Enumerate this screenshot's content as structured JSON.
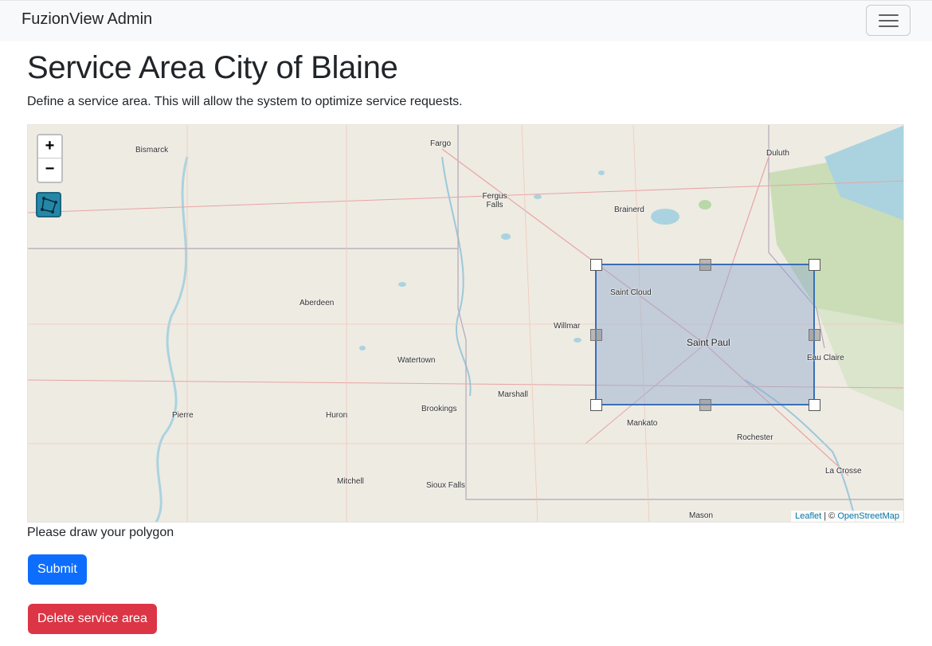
{
  "navbar": {
    "brand": "FuzionView Admin",
    "toggler_icon": "hamburger-menu-icon"
  },
  "page": {
    "title": "Service Area City of Blaine",
    "description": "Define a service area. This will allow the system to optimize service requests."
  },
  "map": {
    "zoom_in": "+",
    "zoom_out": "−",
    "draw_tool_icon": "polygon-draw-icon",
    "attribution": {
      "leaflet": "Leaflet",
      "separator": " | © ",
      "osm": "OpenStreetMap"
    },
    "cities": {
      "bismarck": "Bismarck",
      "fargo": "Fargo",
      "duluth": "Duluth",
      "fergus": "Fergus Falls",
      "brainerd": "Brainerd",
      "saint_cloud": "Saint Cloud",
      "aberdeen": "Aberdeen",
      "willmar": "Willmar",
      "saint_paul": "Saint Paul",
      "eau_claire": "Eau Claire",
      "watertown": "Watertown",
      "marshall": "Marshall",
      "pierre": "Pierre",
      "huron": "Huron",
      "brookings": "Brookings",
      "mankato": "Mankato",
      "rochester": "Rochester",
      "la_crosse": "La Crosse",
      "mitchell": "Mitchell",
      "sioux_falls": "Sioux Falls",
      "mason": "Mason"
    },
    "colors": {
      "polygon_stroke": "#3a6fb5",
      "polygon_fill": "#8da9cf",
      "water": "#aad3df",
      "forest": "#b8d8a5"
    }
  },
  "hint": "Please draw your polygon",
  "buttons": {
    "submit": "Submit",
    "delete": "Delete service area"
  }
}
